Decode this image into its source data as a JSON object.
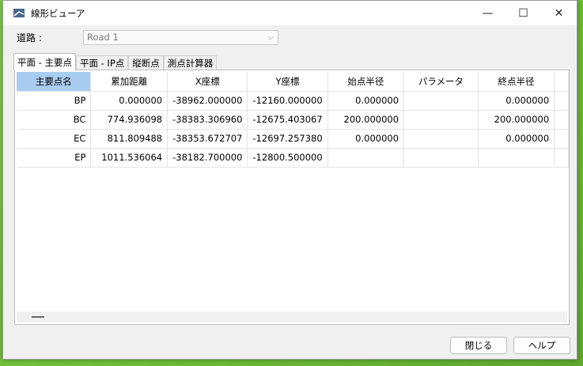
{
  "window": {
    "title": "線形ビューア",
    "controls": {
      "minimize": "—",
      "maximize": "☐",
      "close": "✕"
    }
  },
  "road": {
    "label": "道路 :",
    "value": "Road 1"
  },
  "tabs": [
    "平面 - 主要点",
    "平面 - IP点",
    "縦断点",
    "測点計算器"
  ],
  "table": {
    "headers": [
      "主要点名",
      "累加距離",
      "X座標",
      "Y座標",
      "始点半径",
      "パラメータ",
      "終点半径"
    ],
    "rows": [
      [
        "BP",
        "0.000000",
        "-38962.000000",
        "-12160.000000",
        "0.000000",
        "",
        "0.000000"
      ],
      [
        "BC",
        "774.936098",
        "-38383.306960",
        "-12675.403067",
        "200.000000",
        "",
        "200.000000"
      ],
      [
        "EC",
        "811.809488",
        "-38353.672707",
        "-12697.257380",
        "0.000000",
        "",
        "0.000000"
      ],
      [
        "EP",
        "1011.536064",
        "-38182.700000",
        "-12800.500000",
        "",
        "",
        ""
      ]
    ]
  },
  "buttons": {
    "close": "閉じる",
    "help": "ヘルプ"
  }
}
